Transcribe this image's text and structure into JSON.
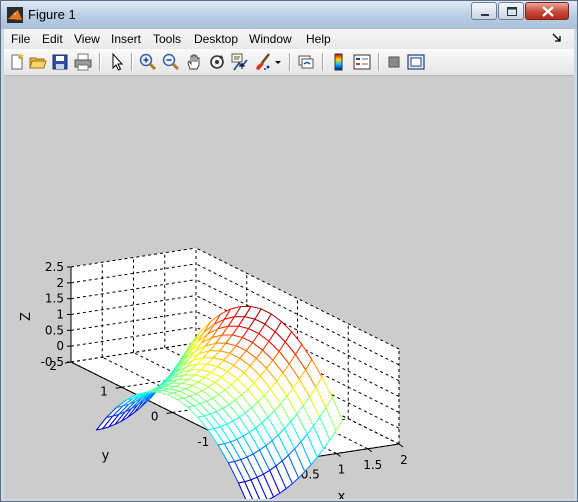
{
  "window": {
    "title": "Figure 1"
  },
  "menu": {
    "items": [
      "File",
      "Edit",
      "View",
      "Insert",
      "Tools",
      "Desktop",
      "Window",
      "Help"
    ]
  },
  "toolbar": {
    "buttons": [
      "new-figure-icon",
      "open-file-icon",
      "save-icon",
      "print-icon",
      "edit-plot-arrow-icon",
      "zoom-in-icon",
      "zoom-out-icon",
      "pan-hand-icon",
      "rotate-3d-icon",
      "data-cursor-icon",
      "brush-icon",
      "brush-dropdown-icon",
      "link-plot-icon",
      "insert-colorbar-icon",
      "insert-legend-icon",
      "hide-plot-tools-icon",
      "show-plot-tools-icon"
    ]
  },
  "colors": {
    "figure_background": "#cccccc",
    "axes_background": "#ffffff"
  },
  "chart_data": {
    "type": "mesh",
    "function": "z = x^2 - y^2 (saddle)",
    "x": [
      0,
      0.1,
      0.2,
      0.3,
      0.4,
      0.5,
      0.6,
      0.7,
      0.8,
      0.9,
      1.0,
      1.1,
      1.2,
      1.3,
      1.4,
      1.5
    ],
    "y": [
      -1.5,
      -1.3,
      -1.1,
      -0.9,
      -0.7,
      -0.5,
      -0.3,
      -0.1,
      0.1,
      0.3,
      0.5,
      0.7,
      0.9,
      1.1,
      1.3,
      1.5
    ],
    "xlabel": "x",
    "ylabel": "y",
    "zlabel": "Z",
    "xlim": [
      0,
      2
    ],
    "ylim": [
      -2,
      2
    ],
    "zlim": [
      -0.5,
      2.5
    ],
    "xticks": [
      "0",
      "0.5",
      "1",
      "1.5",
      "2"
    ],
    "yticks": [
      "-2",
      "-1",
      "0",
      "1",
      "2"
    ],
    "zticks": [
      "-0.5",
      "0",
      "0.5",
      "1",
      "1.5",
      "2",
      "2.5"
    ],
    "grid": true,
    "colormap": "jet"
  }
}
